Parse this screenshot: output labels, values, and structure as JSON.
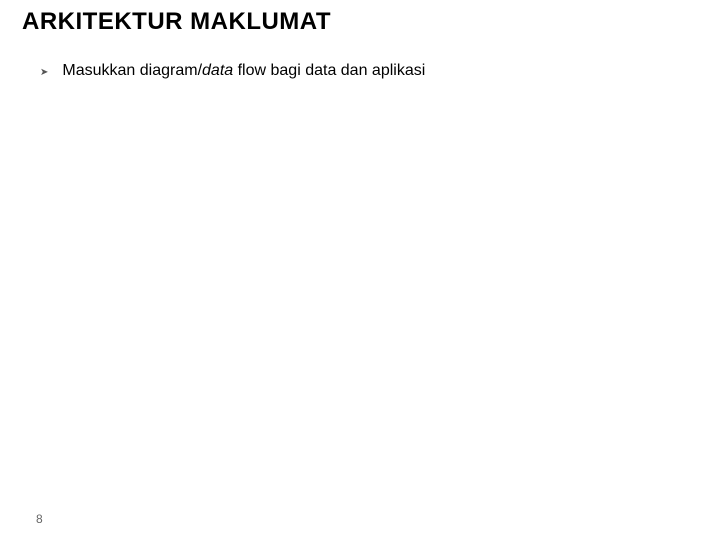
{
  "title": "ARKITEKTUR MAKLUMAT",
  "bullets": [
    {
      "text_before": "Masukkan diagram/",
      "text_italic": "data",
      "text_after": " flow bagi data dan aplikasi"
    }
  ],
  "page_number": "8"
}
